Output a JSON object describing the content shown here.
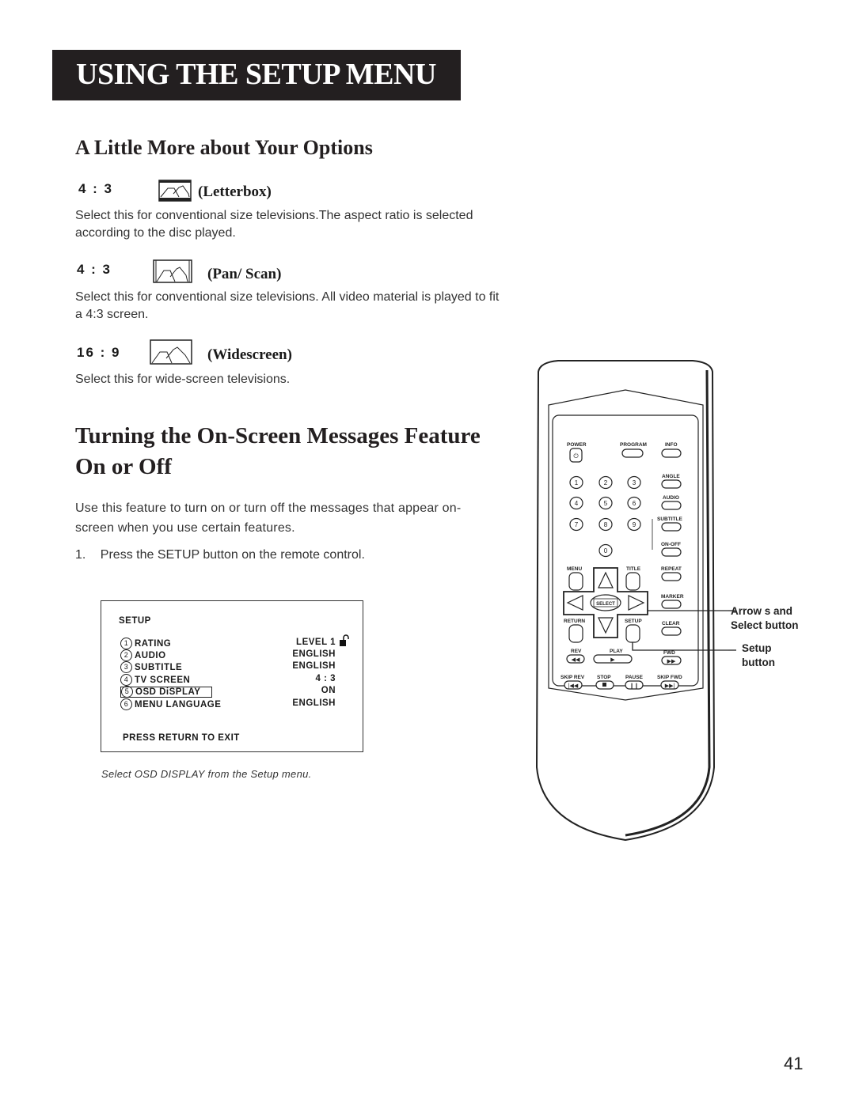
{
  "banner": {
    "title": "USING THE SETUP MENU"
  },
  "section1": {
    "heading": "A Little More about Your Options",
    "options": [
      {
        "ratio": "4 : 3",
        "icon": "letterbox-icon",
        "mode": "(Letterbox)",
        "description": "Select this for conventional size televisions.The aspect ratio is selected according to the disc played."
      },
      {
        "ratio": "4 : 3",
        "icon": "pan-scan-icon",
        "mode": "(Pan/ Scan)",
        "description": "Select this for conventional size televisions. All video material is played to fit a 4:3 screen."
      },
      {
        "ratio": "16 : 9",
        "icon": "widescreen-icon",
        "mode": "(Widescreen)",
        "description": "Select this for wide-screen televisions."
      }
    ]
  },
  "section2": {
    "heading": "Turning the On-Screen Messages Feature On or Off",
    "intro": "Use this feature to turn on or turn off the messages that appear on-screen when you use certain features.",
    "steps": [
      {
        "num": "1.",
        "text": "Press the SETUP button on the remote control."
      }
    ]
  },
  "osd": {
    "title": "SETUP",
    "rows": [
      {
        "num": "1",
        "label": "RATING",
        "value": "LEVEL 1",
        "selected": false,
        "icon": "unlocked-padlock-icon"
      },
      {
        "num": "2",
        "label": "AUDIO",
        "value": "ENGLISH",
        "selected": false
      },
      {
        "num": "3",
        "label": "SUBTITLE",
        "value": "ENGLISH",
        "selected": false
      },
      {
        "num": "4",
        "label": "TV SCREEN",
        "value": "4 : 3",
        "selected": false
      },
      {
        "num": "5",
        "label": "OSD DiSPLAY",
        "value": "ON",
        "selected": true
      },
      {
        "num": "6",
        "label": "MENU LANGUAGE",
        "value": "ENGLISH",
        "selected": false
      }
    ],
    "footer": "PRESS RETURN TO EXIT",
    "caption": "Select OSD DISPLAY from the Setup menu."
  },
  "remote": {
    "buttons": {
      "power": "POWER",
      "program": "PROGRAM",
      "info": "INFO",
      "digits": [
        "1",
        "2",
        "3",
        "4",
        "5",
        "6",
        "7",
        "8",
        "9",
        "0"
      ],
      "angle": "ANGLE",
      "audio": "AUDIO",
      "subtitle": "SUBTITLE",
      "on_off": "ON-OFF",
      "menu": "MENU",
      "title": "TITLE",
      "repeat": "REPEAT",
      "marker": "MARKER",
      "select": "SELECT",
      "return": "RETURN",
      "setup": "SETUP",
      "clear": "CLEAR",
      "rev": "REV",
      "play": "PLAY",
      "fwd": "FWD",
      "skip_rev": "SKIP REV",
      "stop": "STOP",
      "pause": "PAUSE",
      "skip_fwd": "SKIP FWD"
    },
    "callouts": {
      "arrows_select": [
        "Arrow s and",
        "Select button"
      ],
      "setup": [
        "Setup",
        "button"
      ]
    }
  },
  "page_number": "41"
}
